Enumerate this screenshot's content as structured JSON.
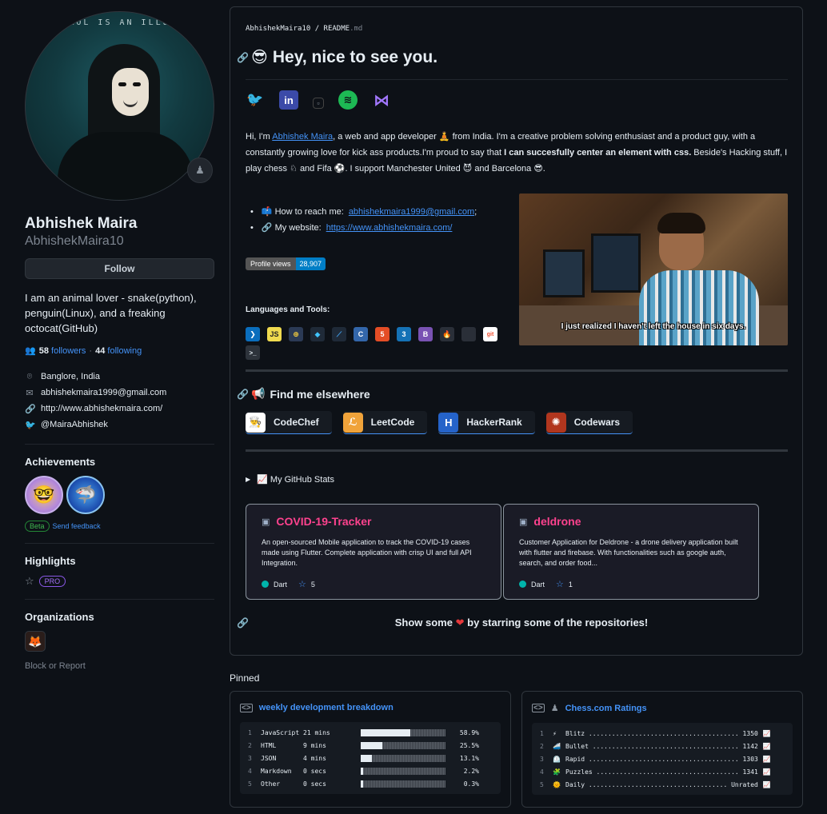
{
  "profile": {
    "avatar_text": "ROL IS AN ILLU",
    "name": "Abhishek Maira",
    "login": "AbhishekMaira10",
    "follow_label": "Follow",
    "bio": "I am an animal lover - snake(python), penguin(Linux), and a freaking octocat(GitHub)",
    "followers_count": "58",
    "followers_label": "followers",
    "separator": "·",
    "following_count": "44",
    "following_label": "following",
    "location": "Banglore, India",
    "email": "abhishekmaira1999@gmail.com",
    "website": "http://www.abhishekmaira.com/",
    "twitter": "@MairaAbhishek",
    "achievements_title": "Achievements",
    "beta_label": "Beta",
    "feedback_label": "Send feedback",
    "highlights_title": "Highlights",
    "pro_label": "PRO",
    "organizations_title": "Organizations",
    "block_label": "Block or Report"
  },
  "readme": {
    "crumb_user": "AbhishekMaira10",
    "crumb_sep": "/",
    "crumb_file": "README",
    "crumb_ext": ".md",
    "greeting_emoji": "😎",
    "greeting": "Hey, nice to see you.",
    "intro_1": "Hi, I'm ",
    "intro_link": "Abhishek Maira",
    "intro_2": ", a web and app developer 🧘 from India. I'm a creative problem solving enthusiast and a product guy, with a constantly growing love for kick ass products.I'm proud to say that ",
    "intro_bold": "I can succesfully center an element with css.",
    "intro_3": " Beside's Hacking stuff, I play chess ♘ and Fifa ⚽. I support Manchester United 😈 and Barcelona 😎.",
    "reach_label": "📫 How to reach me:",
    "reach_email": "abhishekmaira1999@gmail.com",
    "reach_end": ";",
    "website_label": "🔗 My website:",
    "website_url": "https://www.abhishekmaira.com/",
    "views_label": "Profile views",
    "views_count": "28,907",
    "tools_title": "Languages and Tools:",
    "gif_caption": "I just realized I haven't left the house in six days.",
    "find_emoji": "📢",
    "find_title": "Find me elsewhere",
    "platforms": [
      "CodeChef",
      "LeetCode",
      "HackerRank",
      "Codewars"
    ],
    "stats_label": "📈 My GitHub Stats",
    "repos": [
      {
        "name": "COVID-19-Tracker",
        "desc": "An open-sourced Mobile application to track the COVID-19 cases made using Flutter. Complete application with crisp UI and full API Integration.",
        "lang": "Dart",
        "stars": "5"
      },
      {
        "name": "deldrone",
        "desc": "Customer Application for Deldrone - a drone delivery application built with flutter and firebase. With functionalities such as google auth, search, and order food...",
        "lang": "Dart",
        "stars": "1"
      }
    ],
    "show_1": "Show some",
    "show_2": "by starring some of the repositories!"
  },
  "pinned": {
    "title": "Pinned",
    "wakatime_title": "weekly development breakdown",
    "wakatime_rows": [
      {
        "n": "1",
        "lang": "JavaScript",
        "time": "21 mins",
        "pct": "58.9%",
        "fraction": 0.589
      },
      {
        "n": "2",
        "lang": "HTML",
        "time": "9 mins",
        "pct": "25.5%",
        "fraction": 0.255
      },
      {
        "n": "3",
        "lang": "JSON",
        "time": "4 mins",
        "pct": "13.1%",
        "fraction": 0.131
      },
      {
        "n": "4",
        "lang": "Markdown",
        "time": "0 secs",
        "pct": "2.2%",
        "fraction": 0.022
      },
      {
        "n": "5",
        "lang": "Other",
        "time": "0 secs",
        "pct": "0.3%",
        "fraction": 0.003
      }
    ],
    "chess_title": "Chess.com Ratings",
    "chess_rows": [
      {
        "n": "1",
        "icon": "⚡",
        "line": "Blitz ....................................... 1350",
        "trend": "📈"
      },
      {
        "n": "2",
        "icon": "🚄",
        "line": "Bullet ...................................... 1142",
        "trend": "📈"
      },
      {
        "n": "3",
        "icon": "⏲️",
        "line": "Rapid ....................................... 1303",
        "trend": "📈"
      },
      {
        "n": "4",
        "icon": "🧩",
        "line": "Puzzles ..................................... 1341",
        "trend": "📈"
      },
      {
        "n": "5",
        "icon": "🌞",
        "line": "Daily .................................... Unrated",
        "trend": "📈"
      }
    ]
  }
}
